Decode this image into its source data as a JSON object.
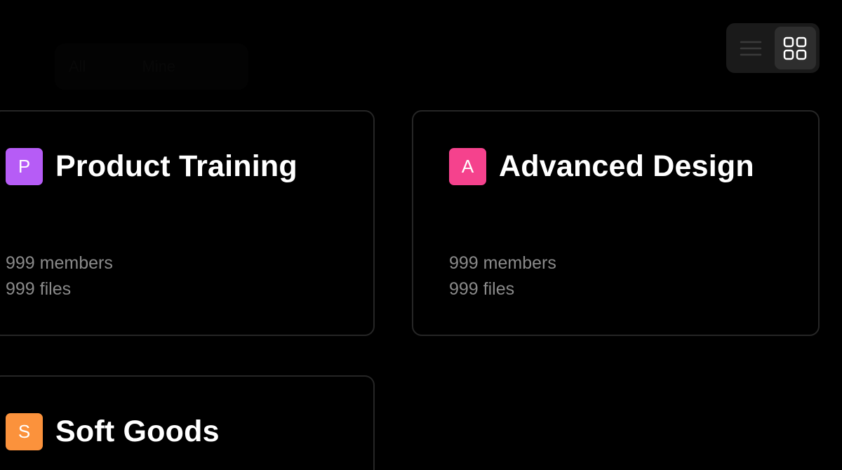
{
  "filter_tabs": [
    "All",
    "Mine"
  ],
  "view_toggle": {
    "list_icon": "list-icon",
    "grid_icon": "grid-icon",
    "active": "grid"
  },
  "teams": [
    {
      "initial": "P",
      "name": "Product Training",
      "members": "999 members",
      "files": "999 files",
      "color": "#b65cf6"
    },
    {
      "initial": "A",
      "name": "Advanced Design",
      "members": "999 members",
      "files": "999 files",
      "color": "#f5428d"
    },
    {
      "initial": "S",
      "name": "Soft Goods",
      "members": "",
      "files": "",
      "color": "#fb923c"
    }
  ]
}
